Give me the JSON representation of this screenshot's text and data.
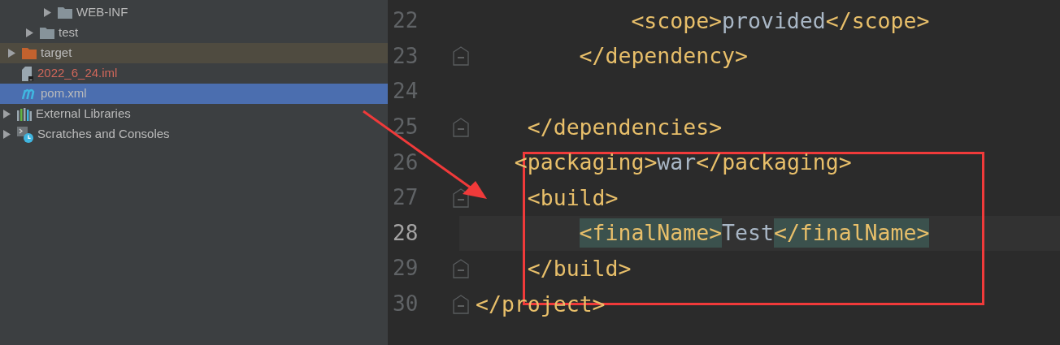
{
  "sidebar": {
    "tree": [
      {
        "children": [
          {
            "children": [
              {
                "children": [
                  {
                    "label": "WEB-INF",
                    "kind": "folder",
                    "expandable": true,
                    "selected": false,
                    "excluded": false
                  }
                ]
              },
              {
                "label": "test",
                "kind": "folder",
                "expandable": true,
                "selected": false,
                "excluded": false
              }
            ]
          },
          {
            "label": "target",
            "kind": "excluded-folder",
            "expandable": true,
            "selected": false,
            "excluded": true
          },
          {
            "label": "2022_6_24.iml",
            "kind": "file",
            "expandable": false,
            "selected": false,
            "excluded": false,
            "color": "#d1675a"
          },
          {
            "label": "pom.xml",
            "kind": "maven",
            "expandable": false,
            "selected": true,
            "excluded": false
          }
        ]
      },
      {
        "label": "External Libraries",
        "kind": "libraries",
        "expandable": true,
        "selected": false,
        "excluded": false
      },
      {
        "label": "Scratches and Consoles",
        "kind": "scratches",
        "expandable": true,
        "selected": false,
        "excluded": false
      }
    ]
  },
  "editor": {
    "lines": [
      {
        "number": "22",
        "fold": false,
        "current": false,
        "segments": [
          {
            "kind": "tag",
            "text": "<scope>",
            "matched": false
          },
          {
            "kind": "text",
            "text": "provided",
            "matched": false
          },
          {
            "kind": "tag",
            "text": "</scope>",
            "matched": false
          }
        ]
      },
      {
        "number": "23",
        "fold": true,
        "current": false,
        "segments": [
          {
            "kind": "tag",
            "text": "</dependency>",
            "matched": false
          }
        ]
      },
      {
        "number": "24",
        "fold": false,
        "current": false
      },
      {
        "number": "25",
        "fold": true,
        "current": false,
        "segments": [
          {
            "kind": "tag",
            "text": "</dependencies>",
            "matched": false
          }
        ]
      },
      {
        "number": "26",
        "fold": false,
        "current": false,
        "segments": [
          {
            "kind": "tag",
            "text": "<packaging>",
            "matched": false
          },
          {
            "kind": "text",
            "text": "war",
            "matched": false
          },
          {
            "kind": "tag",
            "text": "</packaging>",
            "matched": false
          }
        ]
      },
      {
        "number": "27",
        "fold": true,
        "current": false,
        "segments": [
          {
            "kind": "tag",
            "text": "<build>",
            "matched": false
          }
        ]
      },
      {
        "number": "28",
        "fold": false,
        "current": true,
        "segments": [
          {
            "kind": "tag",
            "text": "<finalName>",
            "matched": true
          },
          {
            "kind": "text",
            "text": "Test",
            "matched": false
          },
          {
            "kind": "tag",
            "text": "</finalName>",
            "matched": true
          }
        ]
      },
      {
        "number": "29",
        "fold": true,
        "current": false,
        "segments": [
          {
            "kind": "tag",
            "text": "</build>",
            "matched": false
          }
        ]
      },
      {
        "number": "30",
        "fold": true,
        "current": false,
        "segments": [
          {
            "kind": "tag",
            "text": "</project>",
            "matched": false
          }
        ]
      }
    ]
  }
}
